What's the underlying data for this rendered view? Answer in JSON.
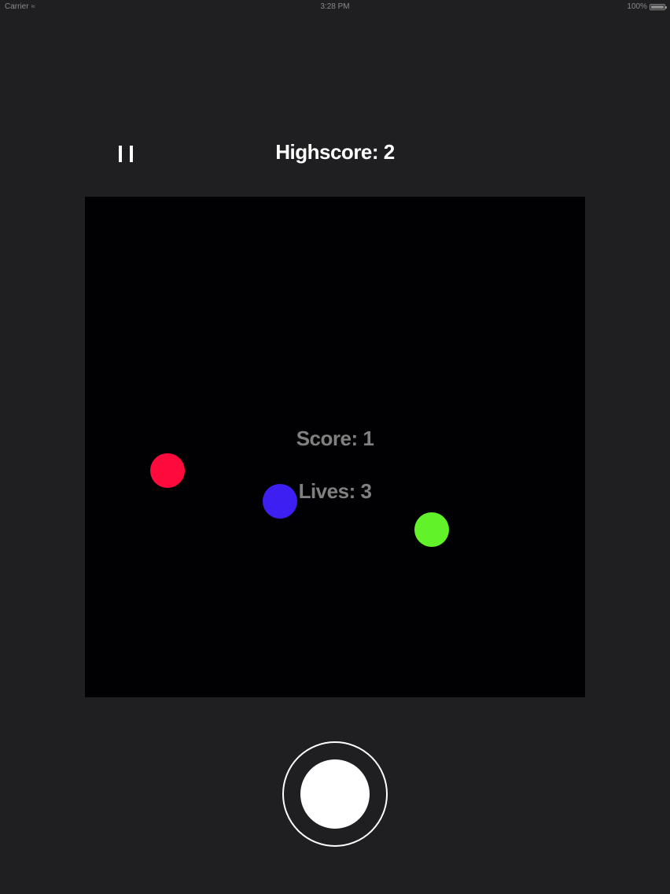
{
  "status_bar": {
    "carrier": "Carrier",
    "time": "3:28 PM",
    "battery": "100%"
  },
  "header": {
    "pause_icon": "pause-icon",
    "highscore_text": "Highscore: 2"
  },
  "board": {
    "score_text": "Score: 1",
    "lives_text": "Lives: 3",
    "balls": [
      {
        "name": "red-ball",
        "color": "#ff0a3c"
      },
      {
        "name": "blue-ball",
        "color": "#3e1ff2"
      },
      {
        "name": "green-ball",
        "color": "#62f22a"
      }
    ]
  },
  "controls": {
    "action_icon": "record-button-icon"
  },
  "colors": {
    "background": "#1f1e20",
    "board": "#010002",
    "board_text": "#808080",
    "header_text": "#ffffff"
  }
}
